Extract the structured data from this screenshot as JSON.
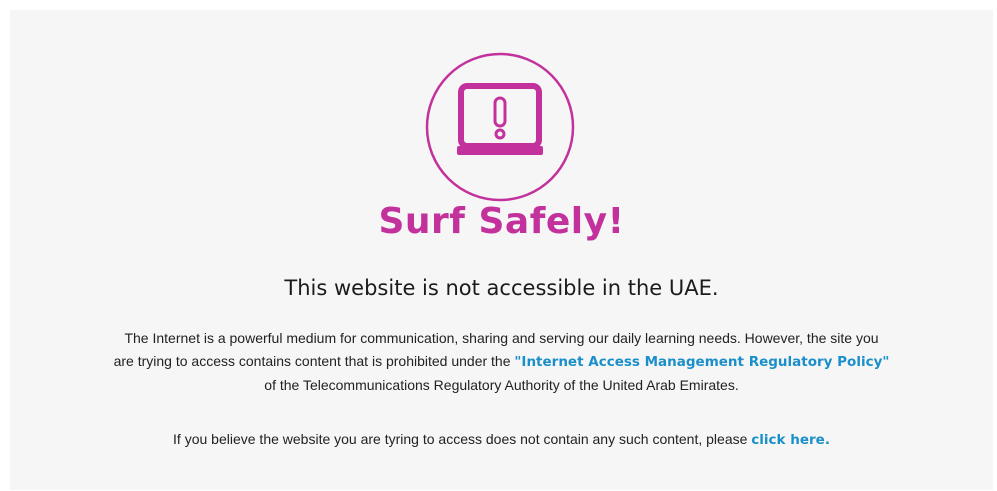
{
  "page": {
    "title": "Surf Safely!",
    "subtitle": "This website is not accessible in the UAE.",
    "paragraph": {
      "line1": "The Internet is a powerful medium for communication, sharing and serving our daily learning needs. However, the site you",
      "line2_before": "are trying to access contains content that is prohibited under the ",
      "policy_link": "\"Internet Access Management Regulatory Policy\"",
      "line3": "of the Telecommunications Regulatory Authority of the United Arab Emirates."
    },
    "help": {
      "text": "If you believe the website you are tyring to access does not contain any such content, please ",
      "link": "click here."
    },
    "icon": "warning-laptop-icon"
  },
  "colors": {
    "accent": "#c2319c",
    "link": "#1a8fca",
    "background": "#f6f6f6",
    "text": "#222222"
  }
}
